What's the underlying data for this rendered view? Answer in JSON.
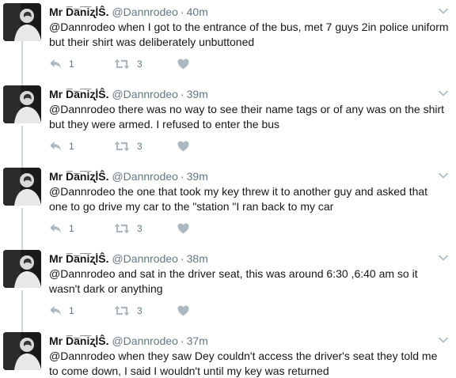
{
  "tweets": [
    {
      "name": "Mr D̅a̅n̅i̅ʐl̇Ŝ.",
      "handle": "@Dannrodeo",
      "time": "40m",
      "text": "@Dannrodeo when I got to the entrance of the bus, met 7 guys 2in police uniform but their shirt was deliberately unbuttoned",
      "replies": "1",
      "retweets": "3"
    },
    {
      "name": "Mr D̅a̅n̅i̅ʐl̇Ŝ.",
      "handle": "@Dannrodeo",
      "time": "39m",
      "text": "@Dannrodeo there was no way to see their name tags or of any was on the shirt but they were armed. I refused to enter the bus",
      "replies": "1",
      "retweets": "3"
    },
    {
      "name": "Mr D̅a̅n̅i̅ʐl̇Ŝ.",
      "handle": "@Dannrodeo",
      "time": "39m",
      "text": "@Dannrodeo the one that took my key threw it to another guy and asked that one to go drive my car to the \"station \"I ran back to my car",
      "replies": "1",
      "retweets": "3"
    },
    {
      "name": "Mr D̅a̅n̅i̅ʐl̇Ŝ.",
      "handle": "@Dannrodeo",
      "time": "38m",
      "text": "@Dannrodeo and sat in the driver seat, this was around 6:30 ,6:40 am so it wasn't dark or anything",
      "replies": "1",
      "retweets": "3"
    },
    {
      "name": "Mr D̅a̅n̅i̅ʐl̇Ŝ.",
      "handle": "@Dannrodeo",
      "time": "37m",
      "text": "@Dannrodeo when they saw Dey couldn't access the driver's seat they told me to come down, I said I wouldn't until my key was returned",
      "replies": "",
      "retweets": ""
    }
  ],
  "icons": {
    "reply": "reply-icon",
    "retweet": "retweet-icon",
    "like": "heart-icon",
    "menu": "chevron-down-icon"
  },
  "colors": {
    "name": "#14171a",
    "meta": "#657786",
    "icon": "#aab8c2",
    "thread_line": "#ccd6dd"
  }
}
